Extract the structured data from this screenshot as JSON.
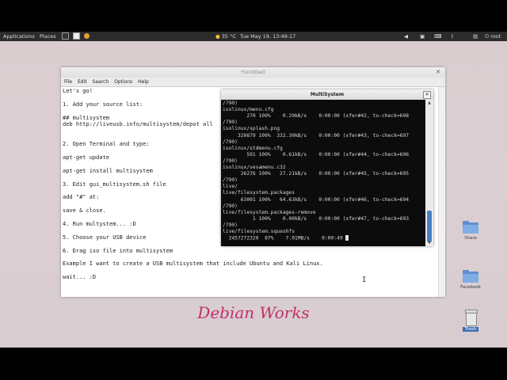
{
  "panel": {
    "applications_label": "Applications",
    "places_label": "Places",
    "weather": "35 °C",
    "clock": "Tue May 19, 13:49:17",
    "user": "root"
  },
  "gedit": {
    "title": "*(Untitled)",
    "menu": [
      "File",
      "Edit",
      "Search",
      "Options",
      "Help"
    ],
    "lines": [
      "Let's go!",
      "",
      "1. Add your source list:",
      "",
      "## multisystem",
      "deb http://liveusb.info/multisystem/depot all",
      "",
      "",
      "2. Open Terminal and type:",
      "",
      "apt-get update",
      "",
      "apt-get install multisystem",
      "",
      "3. Edit gui_multisystem.sh file",
      "",
      "add \"#\" at:",
      "",
      "save & close.",
      "",
      "4. Run multystem... :D",
      "",
      "5. Choose your USB device",
      "",
      "6. Drag iso file into multisystem",
      "",
      "Example I want to create a USB multisystem that include Ubuntu and Kali Linux.",
      "",
      "wait... :D"
    ]
  },
  "terminal": {
    "title": "MultiSystem",
    "lines": [
      "/790)",
      "isolinux/menu.cfg",
      "        270 100%    0.29kB/s    0:00:00 (xfer#42, to-check=698",
      "/790)",
      "isolinux/splash.png",
      "     320879 100%  332.30kB/s    0:00:00 (xfer#43, to-check=697",
      "/790)",
      "isolinux/stdmenu.cfg",
      "        591 100%    0.61kB/s    0:00:00 (xfer#44, to-check=696",
      "/790)",
      "isolinux/vesamenu.c32",
      "      26276 100%   27.21kB/s    0:00:00 (xfer#45, to-check=695",
      "/790)",
      "live/",
      "live/filesystem.packages",
      "      63001 100%   64.63kB/s    0:00:00 (xfer#46, to-check=694",
      "/790)",
      "live/filesystem.packages-remove",
      "          1 100%    0.00kB/s    0:00:00 (xfer#47, to-check=693",
      "/790)",
      "live/filesystem.squashfs",
      "  2457272320  87%    7.01MB/s    0:00:49"
    ]
  },
  "desktop": {
    "icons": [
      {
        "label": "Share",
        "icon": "folder-icon"
      },
      {
        "label": "Facebook",
        "icon": "folder-icon"
      },
      {
        "label": "Trash",
        "icon": "trash-icon"
      }
    ],
    "watermark": "Debian Works"
  }
}
